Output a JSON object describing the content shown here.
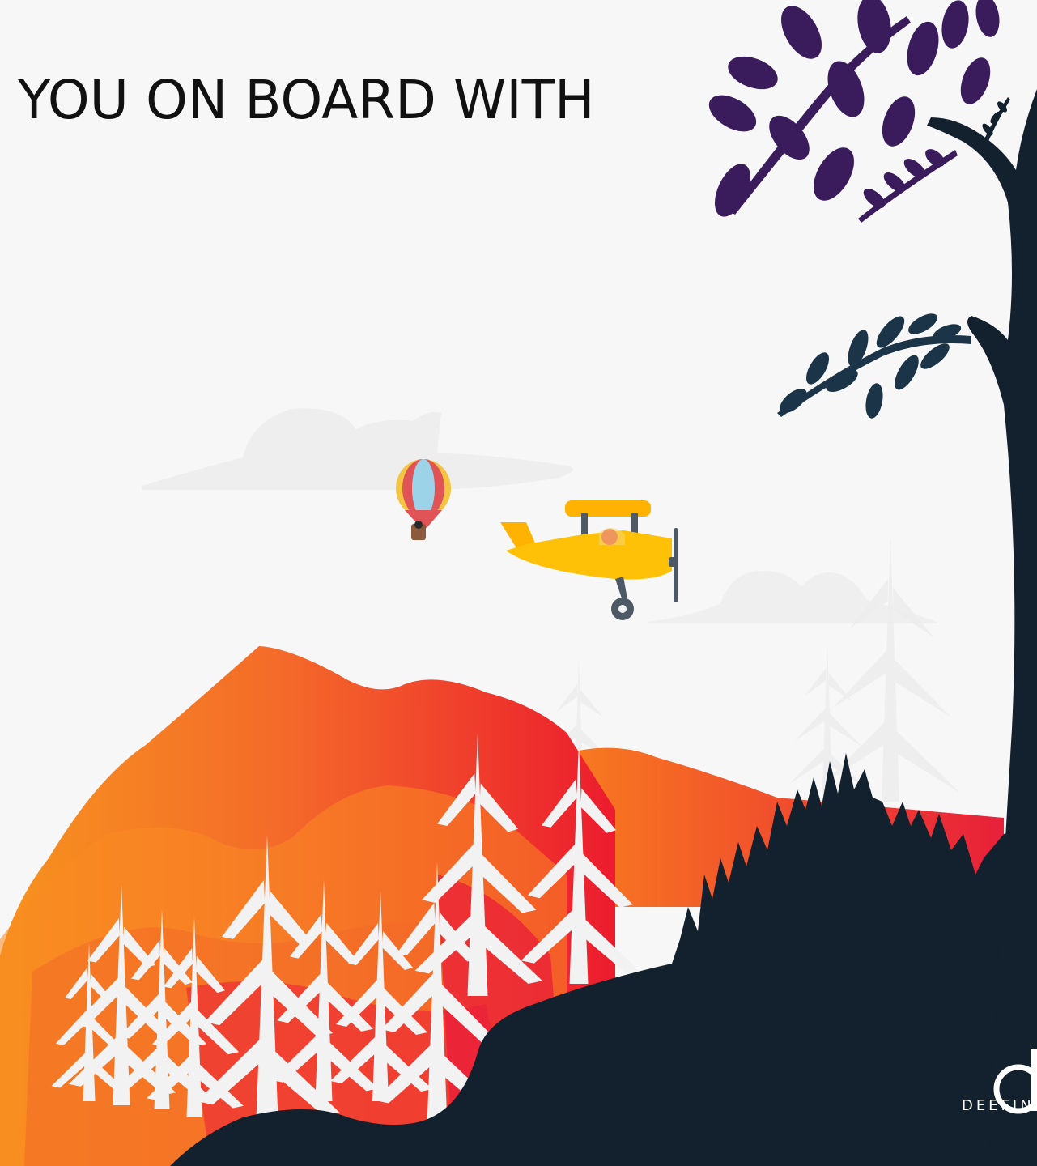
{
  "headline": "YOU ON BOARD WITH",
  "brand": {
    "logo_letter": "d",
    "wordmark": "DEEFINI"
  },
  "colors": {
    "background": "#f7f7f7",
    "mountain_orange": "#f7931e",
    "mountain_red": "#ec1c2e",
    "forest_dark": "#13202d",
    "leaves_purple": "#3a1b5c",
    "plane_yellow": "#ffc107"
  },
  "icons": [
    "hot-air-balloon",
    "biplane",
    "tree-silhouette",
    "brand-logo"
  ]
}
